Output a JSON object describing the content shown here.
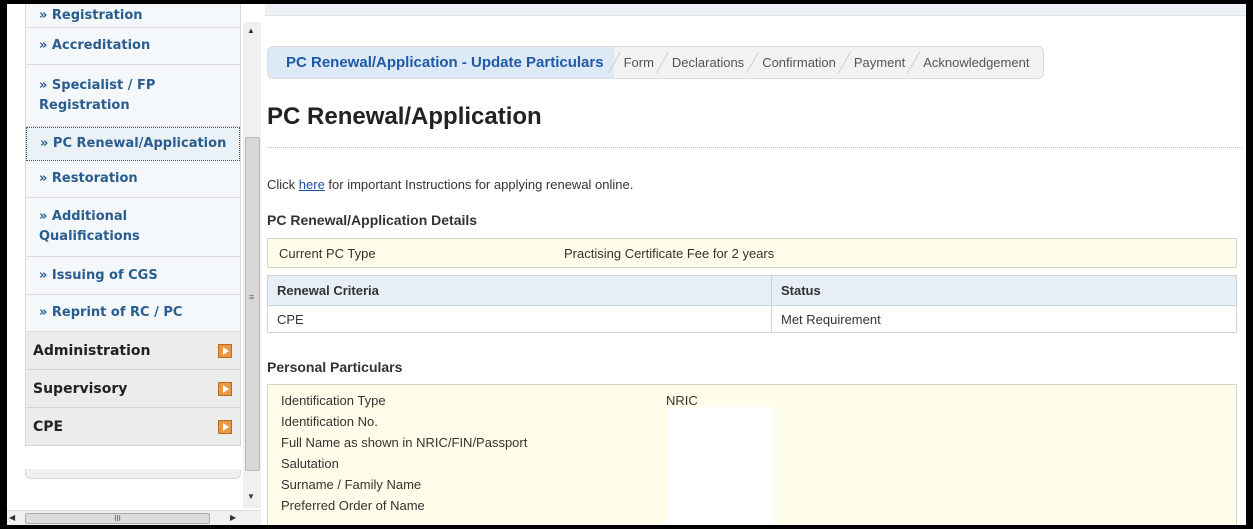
{
  "sidebar": {
    "items": [
      {
        "label": "» Registration"
      },
      {
        "label": "» Accreditation"
      },
      {
        "label": "» Specialist / FP Registration"
      },
      {
        "label": "» PC Renewal/Application"
      },
      {
        "label": "» Restoration"
      },
      {
        "label": "» Additional Qualifications"
      },
      {
        "label": "» Issuing of CGS"
      },
      {
        "label": "» Reprint of RC / PC"
      }
    ],
    "categories": [
      {
        "label": "Administration"
      },
      {
        "label": "Supervisory"
      },
      {
        "label": "CPE"
      }
    ],
    "scroll_grip": "≡",
    "hscroll_grip": "III"
  },
  "wizard": {
    "steps": [
      {
        "label": "PC Renewal/Application - Update Particulars"
      },
      {
        "label": "Form"
      },
      {
        "label": "Declarations"
      },
      {
        "label": "Confirmation"
      },
      {
        "label": "Payment"
      },
      {
        "label": "Acknowledgement"
      }
    ]
  },
  "page": {
    "title": "PC Renewal/Application",
    "instr_pre": "Click ",
    "instr_link": "here",
    "instr_post": " for important Instructions for applying renewal online."
  },
  "details": {
    "heading": "PC Renewal/Application Details",
    "current_pc_label": "Current PC Type",
    "current_pc_value": "Practising Certificate Fee for 2 years"
  },
  "criteria": {
    "headers": [
      "Renewal Criteria",
      "Status"
    ],
    "rows": [
      [
        "CPE",
        "Met Requirement"
      ]
    ]
  },
  "personal": {
    "heading": "Personal Particulars",
    "rows": [
      {
        "label": "Identification Type",
        "value": "NRIC"
      },
      {
        "label": "Identification No.",
        "value": ""
      },
      {
        "label": "Full Name as shown in NRIC/FIN/Passport",
        "value": ""
      },
      {
        "label": "Salutation",
        "value": ""
      },
      {
        "label": "Surname / Family Name",
        "value": ""
      },
      {
        "label": "Preferred Order of Name",
        "value": ""
      }
    ]
  },
  "colors": {
    "accent": "#1e5aa6",
    "link": "#1a4ea0",
    "sidebar_text": "#2a5d8f",
    "category_arrow": "#e79a43",
    "yellow_panel": "#fdfde9"
  }
}
